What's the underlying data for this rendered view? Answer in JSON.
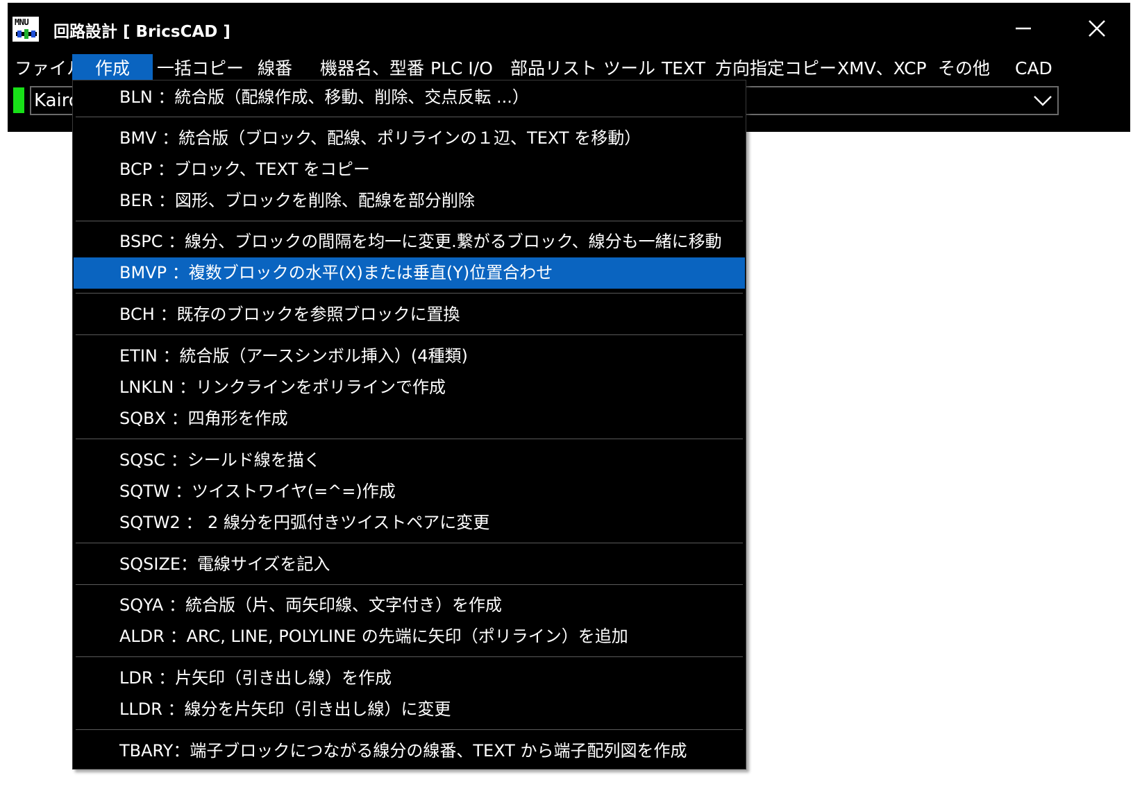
{
  "window": {
    "icon_text": "MNU",
    "title": "回路設計 [ BricsCAD ]"
  },
  "menubar": {
    "items": [
      {
        "label": "ファイル"
      },
      {
        "label": "作成"
      },
      {
        "label": "一括コピー"
      },
      {
        "label": "線番"
      },
      {
        "label": "機器名、型番"
      },
      {
        "label": "PLC I/O"
      },
      {
        "label": "部品リスト"
      },
      {
        "label": "ツール"
      },
      {
        "label": "TEXT"
      },
      {
        "label": "方向指定コピー"
      },
      {
        "label": "XMV、XCP"
      },
      {
        "label": "その他"
      },
      {
        "label": "CAD"
      }
    ],
    "active_item": "作成"
  },
  "toolbar": {
    "combo_value": "Kairo",
    "status_color": "#18e018"
  },
  "dropdown": {
    "highlight_color": "#0a64c0",
    "items": [
      {
        "label": "BLN ：統合版（配線作成、移動、削除、交点反転 ...）"
      },
      {
        "label": "BMV ：統合版（ブロック、配線、ポリラインの１辺、TEXT を移動）"
      },
      {
        "label": "BCP ：ブロック、TEXT をコピー"
      },
      {
        "label": "BER ：図形、ブロックを削除、配線を部分削除"
      },
      {
        "label": "BSPC ：線分、ブロックの間隔を均一に変更.繋がるブロック、線分も一緒に移動"
      },
      {
        "label": "BMVP ：複数ブロックの水平(X)または垂直(Y)位置合わせ"
      },
      {
        "label": "BCH ：既存のブロックを参照ブロックに置換"
      },
      {
        "label": "ETIN ：統合版（アースシンボル挿入）(4種類)"
      },
      {
        "label": "LNKLN ：リンクラインをポリラインで作成"
      },
      {
        "label": "SQBX ：四角形を作成"
      },
      {
        "label": "SQSC ：シールド線を描く"
      },
      {
        "label": "SQTW ：ツイストワイヤ(=^=)作成"
      },
      {
        "label": "SQTW2 ： 2 線分を円弧付きツイストペアに変更"
      },
      {
        "label": "SQSIZE：電線サイズを記入"
      },
      {
        "label": "SQYA ：統合版（片、両矢印線、文字付き）を作成"
      },
      {
        "label": "ALDR ：ARC, LINE, POLYLINE の先端に矢印（ポリライン）を追加"
      },
      {
        "label": "LDR ：片矢印（引き出し線）を作成"
      },
      {
        "label": "LLDR ：線分を片矢印（引き出し線）に変更"
      },
      {
        "label": "TBARY：端子ブロックにつながる線分の線番、TEXT から端子配列図を作成"
      }
    ]
  }
}
